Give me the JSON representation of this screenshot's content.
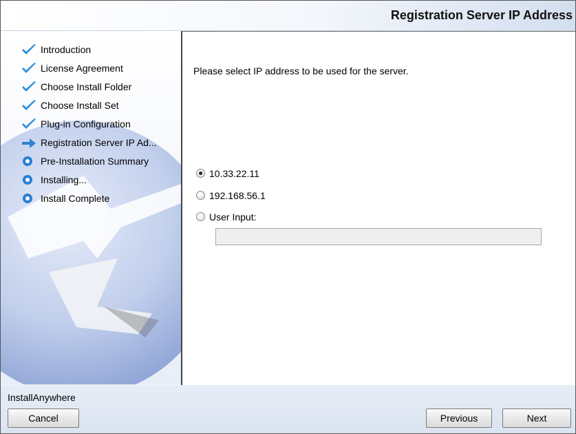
{
  "header": {
    "title": "Registration Server IP Address"
  },
  "sidebar": {
    "steps": [
      {
        "label": "Introduction",
        "status": "done"
      },
      {
        "label": "License Agreement",
        "status": "done"
      },
      {
        "label": "Choose Install Folder",
        "status": "done"
      },
      {
        "label": "Choose Install Set",
        "status": "done"
      },
      {
        "label": "Plug-in Configuration",
        "status": "done"
      },
      {
        "label": "Registration Server IP Ad...",
        "status": "current"
      },
      {
        "label": "Pre-Installation Summary",
        "status": "pending"
      },
      {
        "label": "Installing...",
        "status": "pending"
      },
      {
        "label": "Install Complete",
        "status": "pending"
      }
    ]
  },
  "main": {
    "instruction": "Please select IP address to be used for the server.",
    "options": [
      {
        "label": "10.33.22.11",
        "selected": true
      },
      {
        "label": "192.168.56.1",
        "selected": false
      },
      {
        "label": "User Input:",
        "selected": false
      }
    ],
    "user_input": {
      "value": "",
      "placeholder": ""
    }
  },
  "footer": {
    "brand": "InstallAnywhere",
    "cancel_label": "Cancel",
    "previous_label": "Previous",
    "next_label": "Next"
  },
  "icons": {
    "done": "checkmark-icon",
    "current": "arrow-right-icon",
    "pending": "bullet-circle-icon"
  },
  "colors": {
    "check": "#2e8fd8",
    "arrow": "#2f80cc",
    "bullet": "#2a7fd0",
    "sidebar_globe": "#8fa4d3"
  }
}
